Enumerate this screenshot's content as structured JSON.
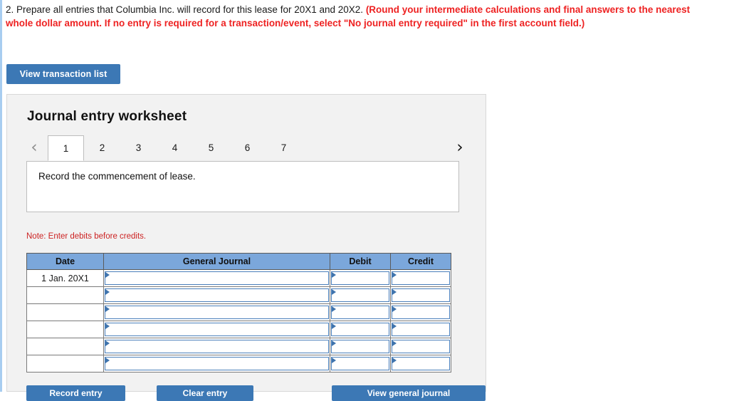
{
  "question": {
    "number": "2.",
    "text_normal": "Prepare all entries that Columbia Inc. will record for this lease for 20X1 and 20X2.",
    "text_bold_red": "(Round your intermediate calculations and final answers to the nearest whole dollar amount. If no entry is required for a transaction/event, select \"No journal entry required\" in the first account field.)"
  },
  "toolbar": {
    "view_transaction_list_label": "View transaction list"
  },
  "worksheet": {
    "title": "Journal entry worksheet",
    "prev_icon": "‹",
    "next_icon": "›",
    "tabs": [
      {
        "label": "1",
        "active": true
      },
      {
        "label": "2",
        "active": false
      },
      {
        "label": "3",
        "active": false
      },
      {
        "label": "4",
        "active": false
      },
      {
        "label": "5",
        "active": false
      },
      {
        "label": "6",
        "active": false
      },
      {
        "label": "7",
        "active": false
      }
    ],
    "tab_content_text": "Record the commencement of lease.",
    "note": "Note: Enter debits before credits."
  },
  "table": {
    "headers": [
      "Date",
      "General Journal",
      "Debit",
      "Credit"
    ],
    "rows": [
      {
        "date": "1 Jan. 20X1",
        "general_journal": "",
        "debit": "",
        "credit": ""
      },
      {
        "date": "",
        "general_journal": "",
        "debit": "",
        "credit": ""
      },
      {
        "date": "",
        "general_journal": "",
        "debit": "",
        "credit": ""
      },
      {
        "date": "",
        "general_journal": "",
        "debit": "",
        "credit": ""
      },
      {
        "date": "",
        "general_journal": "",
        "debit": "",
        "credit": ""
      },
      {
        "date": "",
        "general_journal": "",
        "debit": "",
        "credit": ""
      }
    ]
  },
  "footer": {
    "record_entry_label": "Record entry",
    "clear_entry_label": "Clear entry",
    "view_general_journal_label": "View general journal"
  },
  "colors": {
    "button_blue": "#3c78b5",
    "header_blue": "#7ba7db",
    "field_border_blue": "#4a7fba",
    "marker_blue": "#3f74ad",
    "note_red": "#cc2222",
    "question_red": "#ee2222",
    "panel_grey": "#f2f2f2",
    "rail_blue": "#a8cdf0"
  }
}
